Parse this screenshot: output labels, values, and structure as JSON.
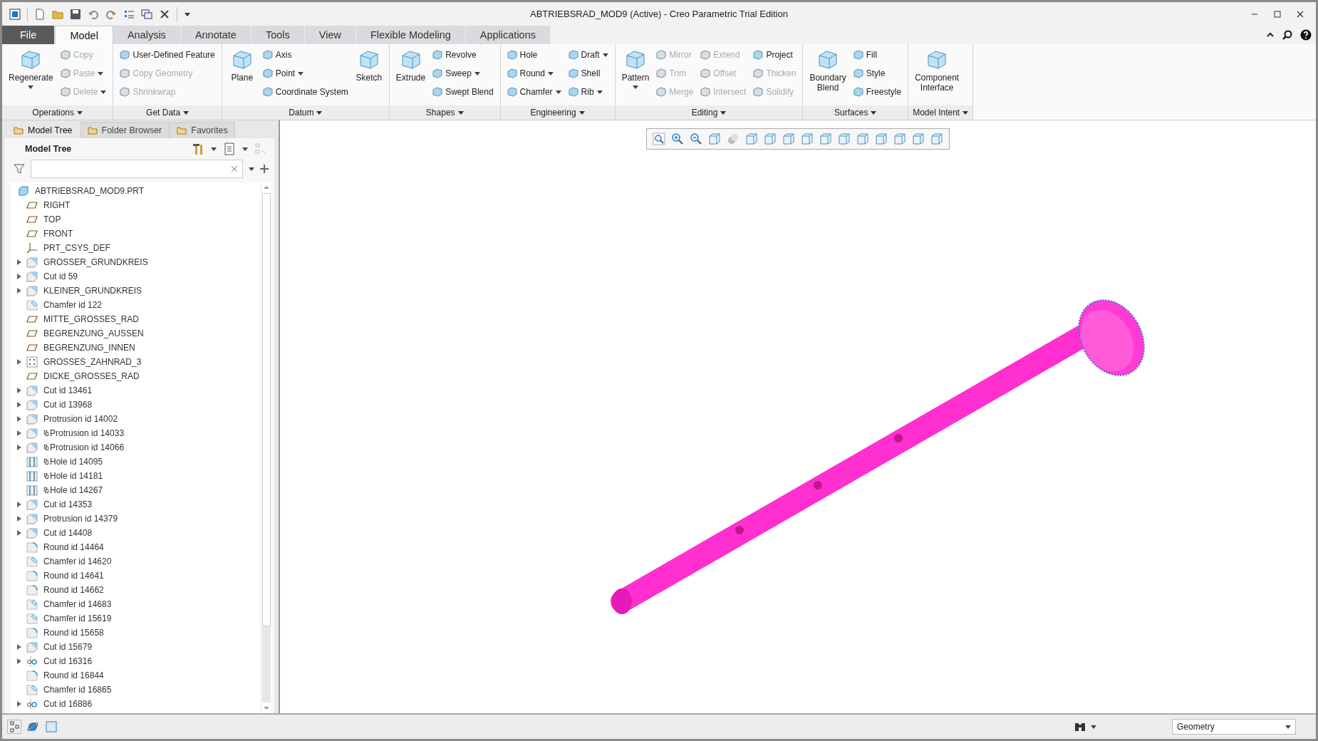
{
  "window": {
    "title": "ABTRIEBSRAD_MOD9 (Active) - Creo Parametric Trial Edition"
  },
  "tabs": [
    {
      "label": "File",
      "kind": "file",
      "selected": false
    },
    {
      "label": "Model",
      "kind": "tab",
      "selected": true
    },
    {
      "label": "Analysis",
      "kind": "tab",
      "selected": false
    },
    {
      "label": "Annotate",
      "kind": "tab",
      "selected": false
    },
    {
      "label": "Tools",
      "kind": "tab",
      "selected": false
    },
    {
      "label": "View",
      "kind": "tab",
      "selected": false
    },
    {
      "label": "Flexible Modeling",
      "kind": "tab",
      "selected": false
    },
    {
      "label": "Applications",
      "kind": "tab",
      "selected": false
    }
  ],
  "ribbon_groups": [
    {
      "label": "Operations",
      "columns": [
        {
          "kind": "large",
          "items": [
            {
              "label": "Regenerate",
              "disabled": false,
              "dropdown": true
            }
          ]
        },
        {
          "kind": "stack",
          "items": [
            {
              "label": "Copy",
              "disabled": true,
              "dropdown": false
            },
            {
              "label": "Paste",
              "disabled": true,
              "dropdown": true
            },
            {
              "label": "Delete",
              "disabled": true,
              "dropdown": true
            }
          ]
        }
      ]
    },
    {
      "label": "Get Data",
      "columns": [
        {
          "kind": "stack",
          "items": [
            {
              "label": "User-Defined Feature",
              "disabled": false,
              "dropdown": false
            },
            {
              "label": "Copy Geometry",
              "disabled": true,
              "dropdown": false
            },
            {
              "label": "Shrinkwrap",
              "disabled": true,
              "dropdown": false
            }
          ]
        }
      ]
    },
    {
      "label": "Datum",
      "columns": [
        {
          "kind": "large",
          "items": [
            {
              "label": "Plane",
              "disabled": false,
              "dropdown": false
            }
          ]
        },
        {
          "kind": "stack",
          "items": [
            {
              "label": "Axis",
              "disabled": false,
              "dropdown": false
            },
            {
              "label": "Point",
              "disabled": false,
              "dropdown": true
            },
            {
              "label": "Coordinate System",
              "disabled": false,
              "dropdown": false
            }
          ]
        },
        {
          "kind": "large",
          "items": [
            {
              "label": "Sketch",
              "disabled": false,
              "dropdown": false
            }
          ]
        }
      ]
    },
    {
      "label": "Shapes",
      "columns": [
        {
          "kind": "large",
          "items": [
            {
              "label": "Extrude",
              "disabled": false,
              "dropdown": false
            }
          ]
        },
        {
          "kind": "stack",
          "items": [
            {
              "label": "Revolve",
              "disabled": false,
              "dropdown": false
            },
            {
              "label": "Sweep",
              "disabled": false,
              "dropdown": true
            },
            {
              "label": "Swept Blend",
              "disabled": false,
              "dropdown": false
            }
          ]
        }
      ]
    },
    {
      "label": "Engineering",
      "columns": [
        {
          "kind": "stack",
          "items": [
            {
              "label": "Hole",
              "disabled": false,
              "dropdown": false
            },
            {
              "label": "Round",
              "disabled": false,
              "dropdown": true
            },
            {
              "label": "Chamfer",
              "disabled": false,
              "dropdown": true
            }
          ]
        },
        {
          "kind": "stack",
          "items": [
            {
              "label": "Draft",
              "disabled": false,
              "dropdown": true
            },
            {
              "label": "Shell",
              "disabled": false,
              "dropdown": false
            },
            {
              "label": "Rib",
              "disabled": false,
              "dropdown": true
            }
          ]
        }
      ]
    },
    {
      "label": "Editing",
      "columns": [
        {
          "kind": "large",
          "items": [
            {
              "label": "Pattern",
              "disabled": false,
              "dropdown": true
            }
          ]
        },
        {
          "kind": "stack",
          "items": [
            {
              "label": "Mirror",
              "disabled": true,
              "dropdown": false
            },
            {
              "label": "Trim",
              "disabled": true,
              "dropdown": false
            },
            {
              "label": "Merge",
              "disabled": true,
              "dropdown": false
            }
          ]
        },
        {
          "kind": "stack",
          "items": [
            {
              "label": "Extend",
              "disabled": true,
              "dropdown": false
            },
            {
              "label": "Offset",
              "disabled": true,
              "dropdown": false
            },
            {
              "label": "Intersect",
              "disabled": true,
              "dropdown": false
            }
          ]
        },
        {
          "kind": "stack",
          "items": [
            {
              "label": "Project",
              "disabled": false,
              "dropdown": false
            },
            {
              "label": "Thicken",
              "disabled": true,
              "dropdown": false
            },
            {
              "label": "Solidify",
              "disabled": true,
              "dropdown": false
            }
          ]
        }
      ]
    },
    {
      "label": "Surfaces",
      "columns": [
        {
          "kind": "large",
          "items": [
            {
              "label": "Boundary Blend",
              "disabled": false,
              "dropdown": false
            }
          ]
        },
        {
          "kind": "stack",
          "items": [
            {
              "label": "Fill",
              "disabled": false,
              "dropdown": false
            },
            {
              "label": "Style",
              "disabled": false,
              "dropdown": false
            },
            {
              "label": "Freestyle",
              "disabled": false,
              "dropdown": false
            }
          ]
        }
      ]
    },
    {
      "label": "Model Intent",
      "columns": [
        {
          "kind": "large",
          "items": [
            {
              "label": "Component Interface",
              "disabled": false,
              "dropdown": false
            }
          ]
        }
      ]
    }
  ],
  "panel_tabs": [
    {
      "label": "Model Tree",
      "selected": true
    },
    {
      "label": "Folder Browser",
      "selected": false
    },
    {
      "label": "Favorites",
      "selected": false
    }
  ],
  "model_tree": {
    "title": "Model Tree",
    "items": [
      {
        "label": "ABTRIEBSRAD_MOD9.PRT",
        "kind": "part",
        "expandable": false,
        "linked": false
      },
      {
        "label": "RIGHT",
        "kind": "plane",
        "expandable": false,
        "linked": false
      },
      {
        "label": "TOP",
        "kind": "plane",
        "expandable": false,
        "linked": false
      },
      {
        "label": "FRONT",
        "kind": "plane",
        "expandable": false,
        "linked": false
      },
      {
        "label": "PRT_CSYS_DEF",
        "kind": "csys",
        "expandable": false,
        "linked": false
      },
      {
        "label": "GROSSER_GRUNDKREIS",
        "kind": "extrude",
        "expandable": true,
        "linked": false
      },
      {
        "label": "Cut id 59",
        "kind": "extrude",
        "expandable": true,
        "linked": false
      },
      {
        "label": "KLEINER_GRUNDKREIS",
        "kind": "extrude",
        "expandable": true,
        "linked": false
      },
      {
        "label": "Chamfer id 122",
        "kind": "chamfer",
        "expandable": false,
        "linked": false
      },
      {
        "label": "MITTE_GROSSES_RAD",
        "kind": "plane",
        "expandable": false,
        "linked": false
      },
      {
        "label": "BEGRENZUNG_AUSSEN",
        "kind": "plane",
        "expandable": false,
        "linked": false
      },
      {
        "label": "BEGRENZUNG_INNEN",
        "kind": "plane",
        "expandable": false,
        "linked": false
      },
      {
        "label": "GROSSES_ZAHNRAD_3",
        "kind": "pattern",
        "expandable": true,
        "linked": false
      },
      {
        "label": "DICKE_GROSSES_RAD",
        "kind": "plane",
        "expandable": false,
        "linked": false
      },
      {
        "label": "Cut id 13461",
        "kind": "extrude",
        "expandable": true,
        "linked": false
      },
      {
        "label": "Cut id 13968",
        "kind": "extrude",
        "expandable": true,
        "linked": false
      },
      {
        "label": "Protrusion id 14002",
        "kind": "extrude",
        "expandable": true,
        "linked": false
      },
      {
        "label": "Protrusion id 14033",
        "kind": "extrude",
        "expandable": true,
        "linked": true
      },
      {
        "label": "Protrusion id 14066",
        "kind": "extrude",
        "expandable": true,
        "linked": true
      },
      {
        "label": "Hole id 14095",
        "kind": "hole",
        "expandable": false,
        "linked": true
      },
      {
        "label": "Hole id 14181",
        "kind": "hole",
        "expandable": false,
        "linked": true
      },
      {
        "label": "Hole id 14267",
        "kind": "hole",
        "expandable": false,
        "linked": true
      },
      {
        "label": "Cut id 14353",
        "kind": "extrude",
        "expandable": true,
        "linked": false
      },
      {
        "label": "Protrusion id 14379",
        "kind": "extrude",
        "expandable": true,
        "linked": false
      },
      {
        "label": "Cut id 14408",
        "kind": "extrude",
        "expandable": true,
        "linked": false
      },
      {
        "label": "Round id 14464",
        "kind": "round",
        "expandable": false,
        "linked": false
      },
      {
        "label": "Chamfer id 14620",
        "kind": "chamfer",
        "expandable": false,
        "linked": false
      },
      {
        "label": "Round id 14641",
        "kind": "round",
        "expandable": false,
        "linked": false
      },
      {
        "label": "Round id 14662",
        "kind": "round",
        "expandable": false,
        "linked": false
      },
      {
        "label": "Chamfer id 14683",
        "kind": "chamfer",
        "expandable": false,
        "linked": false
      },
      {
        "label": "Chamfer id 15619",
        "kind": "chamfer",
        "expandable": false,
        "linked": false
      },
      {
        "label": "Round id 15658",
        "kind": "round",
        "expandable": false,
        "linked": false
      },
      {
        "label": "Cut id 15679",
        "kind": "extrude",
        "expandable": true,
        "linked": false
      },
      {
        "label": "Cut id 16316",
        "kind": "revolve",
        "expandable": true,
        "linked": false
      },
      {
        "label": "Round id 16844",
        "kind": "round",
        "expandable": false,
        "linked": false
      },
      {
        "label": "Chamfer id 16865",
        "kind": "chamfer",
        "expandable": false,
        "linked": false
      },
      {
        "label": "Cut id 16886",
        "kind": "revolve",
        "expandable": true,
        "linked": false
      }
    ]
  },
  "status_bar": {
    "selection_filter": "Geometry"
  }
}
